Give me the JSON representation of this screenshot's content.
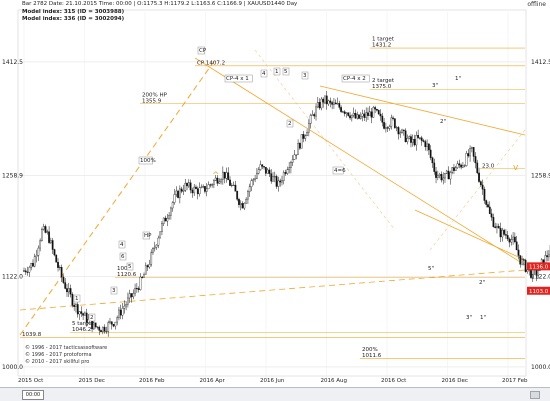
{
  "header": {
    "line1": "Bar 2782  Date: 21.10.2015  Time: 00:00  | O:1175.3  H:1179.2  L:1163.6  C:1166.9  | XAUUSD1440 Day",
    "line2": "Model index: 315 (ID = 3003988)",
    "line3": "Model index: 336 (ID = 3002094)",
    "status": "offline"
  },
  "chart_data": {
    "type": "candlestick",
    "symbol": "XAUUSD1440 Day",
    "y_ticks": [
      1412.5,
      1258.9,
      1122.0,
      1000.0
    ],
    "ylim": [
      985,
      1480
    ],
    "x_ticks": [
      "2015 Oct",
      "2015 Dec",
      "2016 Feb",
      "2016 Apr",
      "2016 Jun",
      "2016 Aug",
      "2016 Oct",
      "2016 Dec",
      "2017 Feb"
    ],
    "price_tags": [
      {
        "value": 1136.0,
        "label": "1136.0"
      },
      {
        "value": 1103.0,
        "label": "1103.0"
      }
    ],
    "close_path": [
      [
        0.0,
        1130
      ],
      [
        0.3,
        1140
      ],
      [
        0.6,
        1185
      ],
      [
        0.8,
        1178
      ],
      [
        1.0,
        1150
      ],
      [
        1.3,
        1115
      ],
      [
        1.5,
        1098
      ],
      [
        1.7,
        1082
      ],
      [
        2.0,
        1068
      ],
      [
        2.3,
        1055
      ],
      [
        2.6,
        1052
      ],
      [
        3.0,
        1062
      ],
      [
        3.3,
        1082
      ],
      [
        3.6,
        1098
      ],
      [
        3.9,
        1118
      ],
      [
        4.2,
        1148
      ],
      [
        4.5,
        1185
      ],
      [
        4.8,
        1212
      ],
      [
        5.0,
        1230
      ],
      [
        5.3,
        1245
      ],
      [
        5.6,
        1240
      ],
      [
        5.9,
        1238
      ],
      [
        6.3,
        1252
      ],
      [
        6.6,
        1262
      ],
      [
        6.9,
        1242
      ],
      [
        7.2,
        1218
      ],
      [
        7.5,
        1248
      ],
      [
        7.8,
        1270
      ],
      [
        8.1,
        1262
      ],
      [
        8.4,
        1245
      ],
      [
        8.7,
        1272
      ],
      [
        9.0,
        1292
      ],
      [
        9.3,
        1318
      ],
      [
        9.6,
        1345
      ],
      [
        9.9,
        1362
      ],
      [
        10.1,
        1355
      ],
      [
        10.4,
        1352
      ],
      [
        10.7,
        1345
      ],
      [
        11.0,
        1335
      ],
      [
        11.3,
        1340
      ],
      [
        11.6,
        1345
      ],
      [
        11.9,
        1328
      ],
      [
        12.2,
        1332
      ],
      [
        12.5,
        1315
      ],
      [
        12.8,
        1303
      ],
      [
        13.0,
        1308
      ],
      [
        13.3,
        1302
      ],
      [
        13.6,
        1262
      ],
      [
        13.9,
        1255
      ],
      [
        14.2,
        1268
      ],
      [
        14.5,
        1275
      ],
      [
        14.8,
        1292
      ],
      [
        15.0,
        1262
      ],
      [
        15.2,
        1235
      ],
      [
        15.4,
        1205
      ],
      [
        15.7,
        1182
      ],
      [
        16.0,
        1178
      ],
      [
        16.2,
        1168
      ],
      [
        16.4,
        1145
      ],
      [
        16.7,
        1128
      ],
      [
        16.9,
        1125
      ],
      [
        17.1,
        1138
      ],
      [
        17.4,
        1158
      ],
      [
        17.7,
        1175
      ],
      [
        17.9,
        1192
      ],
      [
        18.1,
        1205
      ],
      [
        18.3,
        1218
      ]
    ],
    "levels": [
      {
        "value": 1431.2,
        "label": "1 target\n1431.2"
      },
      {
        "value": 1407.2,
        "label": "CP 1407.2"
      },
      {
        "value": 1375.0,
        "label": "2 target\n1375.0"
      },
      {
        "value": 1355.9,
        "label": "200% HP\n1355.9"
      },
      {
        "value": 1120.6,
        "label": "100%\n1120.6"
      },
      {
        "value": 1046.2,
        "label": "5 target\n1046.2"
      },
      {
        "value": 1039.8,
        "label": "1039.8"
      },
      {
        "value": 1011.6,
        "label": "200%\n1011.6"
      },
      {
        "value": 1268.0,
        "label": "23.0"
      }
    ],
    "point_labels": [
      "1",
      "2",
      "3",
      "4",
      "5",
      "6",
      "1",
      "2",
      "3",
      "4",
      "4=6",
      "5",
      "HP",
      "1",
      "2",
      "3",
      "4",
      "5",
      "CP-4 x 1",
      "CP-4 x 2",
      "100%"
    ],
    "star_labels": [
      "1\"",
      "2\"",
      "3\"",
      "5\"",
      "2\"",
      "3\"",
      "1\""
    ]
  },
  "copyright": [
    "© 1996 - 2017 tacticsassoftware",
    "© 1996 - 2017 protoforma",
    "© 2010 - 2017 skillful pro"
  ],
  "footer": {
    "time": "00:00"
  }
}
